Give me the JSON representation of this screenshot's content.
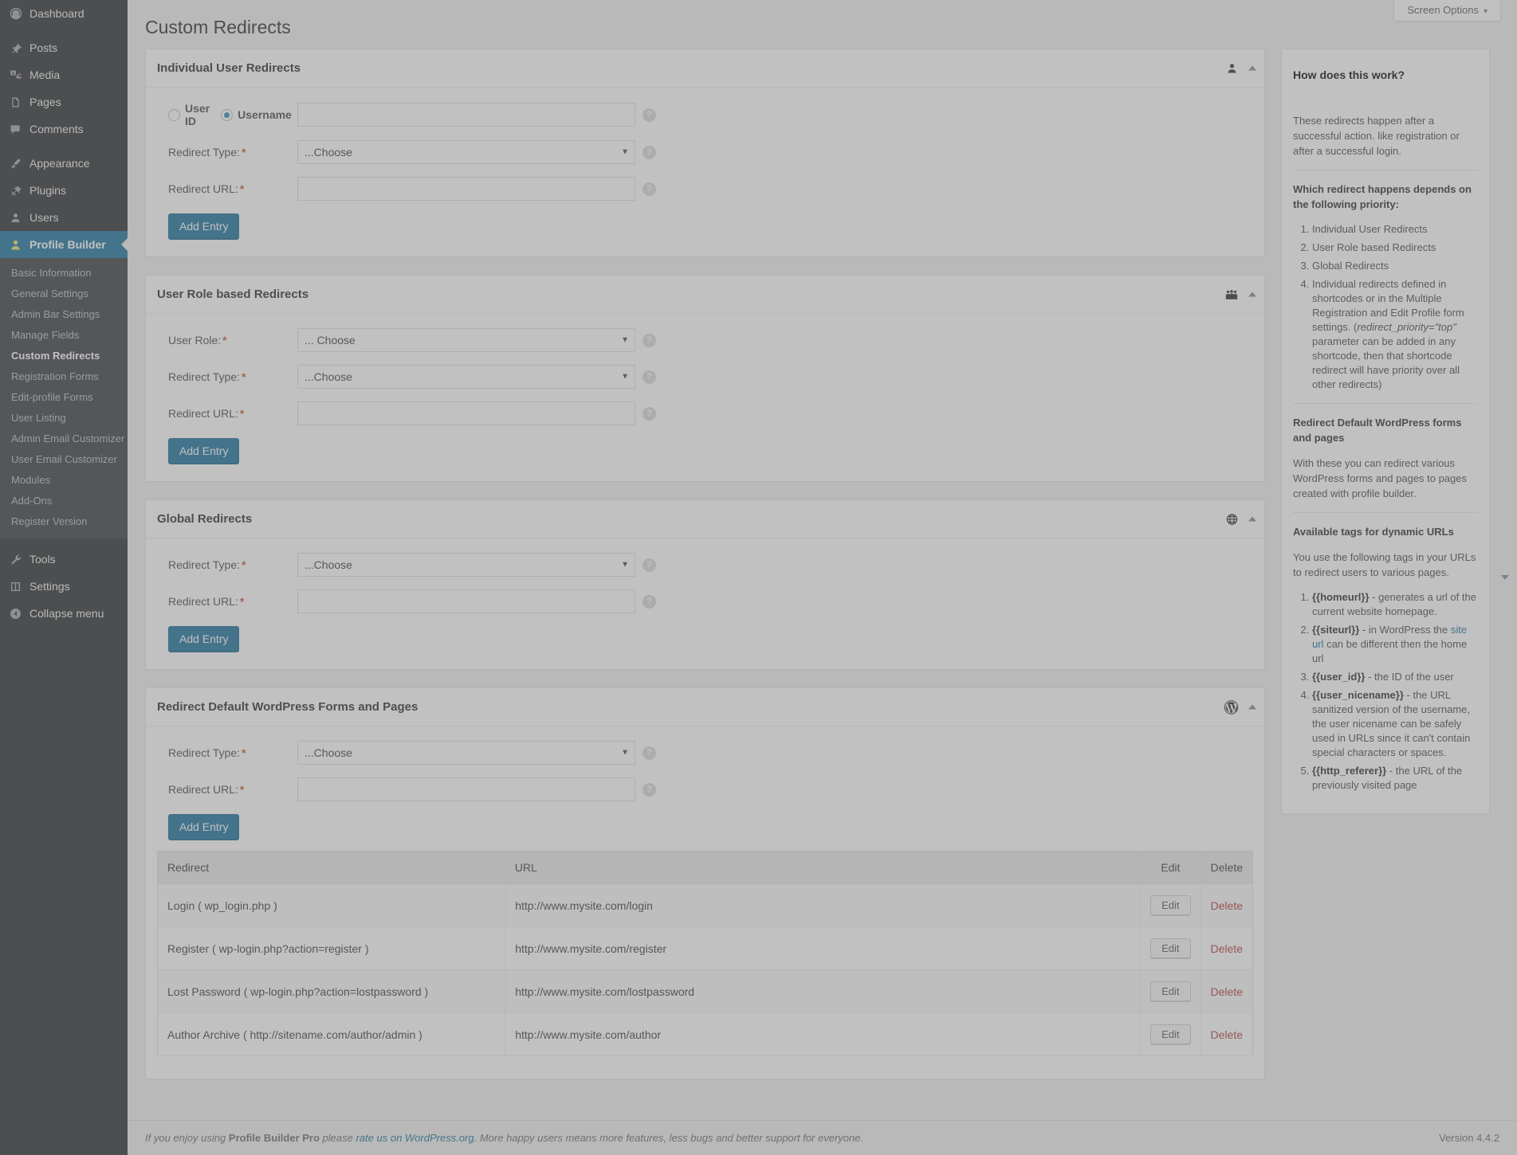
{
  "colors": {
    "admin_bg": "#23282d",
    "submenu_bg": "#32373c",
    "accent_blue": "#0073aa",
    "current_yellow": "#f0de3a",
    "required_red": "#d54e21",
    "delete_red": "#c9302c"
  },
  "screen_options": {
    "label": "Screen Options",
    "caret": "▾"
  },
  "page_title": "Custom Redirects",
  "sidebar": {
    "top_items": [
      {
        "label": "Dashboard",
        "icon": "dashboard-icon"
      },
      {
        "label": "Posts",
        "icon": "pin-icon"
      },
      {
        "label": "Media",
        "icon": "media-icon"
      },
      {
        "label": "Pages",
        "icon": "page-icon"
      },
      {
        "label": "Comments",
        "icon": "comment-icon"
      },
      {
        "label": "Appearance",
        "icon": "brush-icon"
      },
      {
        "label": "Plugins",
        "icon": "plugin-icon"
      },
      {
        "label": "Users",
        "icon": "users-icon"
      },
      {
        "label": "Profile Builder",
        "icon": "person-icon",
        "current": true
      }
    ],
    "submenu": [
      {
        "label": "Basic Information"
      },
      {
        "label": "General Settings"
      },
      {
        "label": "Admin Bar Settings"
      },
      {
        "label": "Manage Fields"
      },
      {
        "label": "Custom Redirects",
        "current": true
      },
      {
        "label": "Registration Forms"
      },
      {
        "label": "Edit-profile Forms"
      },
      {
        "label": "User Listing"
      },
      {
        "label": "Admin Email Customizer"
      },
      {
        "label": "User Email Customizer"
      },
      {
        "label": "Modules"
      },
      {
        "label": "Add-Ons"
      },
      {
        "label": "Register Version"
      }
    ],
    "bottom_items": [
      {
        "label": "Tools",
        "icon": "wrench-icon"
      },
      {
        "label": "Settings",
        "icon": "settings-icon"
      },
      {
        "label": "Collapse menu",
        "icon": "collapse-icon"
      }
    ]
  },
  "panels": {
    "individual": {
      "title": "Individual User Redirects",
      "icon": "user-icon",
      "radio_userid": "User ID",
      "radio_username": "Username",
      "selected_radio": "username",
      "user_value": "",
      "user_placeholder": "",
      "redirect_type_label": "Redirect Type:",
      "redirect_type_value": "...Choose",
      "redirect_url_label": "Redirect URL:",
      "redirect_url_value": "",
      "add_entry": "Add Entry"
    },
    "role": {
      "title": "User Role based Redirects",
      "icon": "group-icon",
      "user_role_label": "User Role:",
      "user_role_value": "... Choose",
      "redirect_type_label": "Redirect Type:",
      "redirect_type_value": "...Choose",
      "redirect_url_label": "Redirect URL:",
      "redirect_url_value": "",
      "add_entry": "Add Entry"
    },
    "global": {
      "title": "Global Redirects",
      "icon": "globe-icon",
      "redirect_type_label": "Redirect Type:",
      "redirect_type_value": "...Choose",
      "redirect_url_label": "Redirect URL:",
      "redirect_url_value": "",
      "add_entry": "Add Entry"
    },
    "wpforms": {
      "title": "Redirect Default WordPress Forms and Pages",
      "icon": "wordpress-icon",
      "redirect_type_label": "Redirect Type:",
      "redirect_type_value": "...Choose",
      "redirect_url_label": "Redirect URL:",
      "redirect_url_value": "",
      "add_entry": "Add Entry",
      "table": {
        "headers": [
          "Redirect",
          "URL",
          "Edit",
          "Delete"
        ],
        "rows": [
          {
            "redirect": "Login ( wp_login.php )",
            "url": "http://www.mysite.com/login",
            "edit": "Edit",
            "delete": "Delete"
          },
          {
            "redirect": "Register ( wp-login.php?action=register )",
            "url": "http://www.mysite.com/register",
            "edit": "Edit",
            "delete": "Delete"
          },
          {
            "redirect": "Lost Password ( wp-login.php?action=lostpassword )",
            "url": "http://www.mysite.com/lostpassword",
            "edit": "Edit",
            "delete": "Delete"
          },
          {
            "redirect": "Author Archive ( http://sitename.com/author/admin )",
            "url": "http://www.mysite.com/author",
            "edit": "Edit",
            "delete": "Delete"
          }
        ]
      }
    }
  },
  "help_panel": {
    "title": "How does this work?",
    "intro": "These redirects happen after a successful action. like registration or after a successful login.",
    "priority_heading": "Which redirect happens depends on the following priority:",
    "priority_items": [
      "Individual User Redirects",
      "User Role based Redirects",
      "Global Redirects"
    ],
    "priority_item_4_a": "Individual redirects defined in shortcodes or in the Multiple Registration and Edit Profile form settings. (",
    "priority_item_4_em": "redirect_priority=\"top\"",
    "priority_item_4_b": " parameter can be added in any shortcode, then that shortcode redirect will have priority over all other redirects)",
    "wpforms_heading": "Redirect Default WordPress forms and pages",
    "wpforms_text": "With these you can redirect various WordPress forms and pages to pages created with profile builder.",
    "tags_heading": "Available tags for dynamic URLs",
    "tags_intro": "You use the following tags in your URLs to redirect users to various pages.",
    "tags": [
      {
        "tag": "{{homeurl}}",
        "desc": " - generates a url of the current website homepage."
      },
      {
        "tag": "{{siteurl}}",
        "desc_a": " - in WordPress the ",
        "link": "site url",
        "desc_b": " can be different then the home url"
      },
      {
        "tag": "{{user_id}}",
        "desc": " - the ID of the user"
      },
      {
        "tag": "{{user_nicename}}",
        "desc": " - the URL sanitized version of the username, the user nicename can be safely used in URLs since it can't contain special characters or spaces."
      },
      {
        "tag": "{{http_referer}}",
        "desc": " - the URL of the previously visited page"
      }
    ]
  },
  "footer": {
    "text_a": "If you enjoy using ",
    "brand": "Profile Builder Pro",
    "text_b": " please ",
    "link": "rate us on WordPress.org",
    "text_c": ". More happy users means more features, less bugs and better support for everyone.",
    "version": "Version 4.4.2"
  }
}
